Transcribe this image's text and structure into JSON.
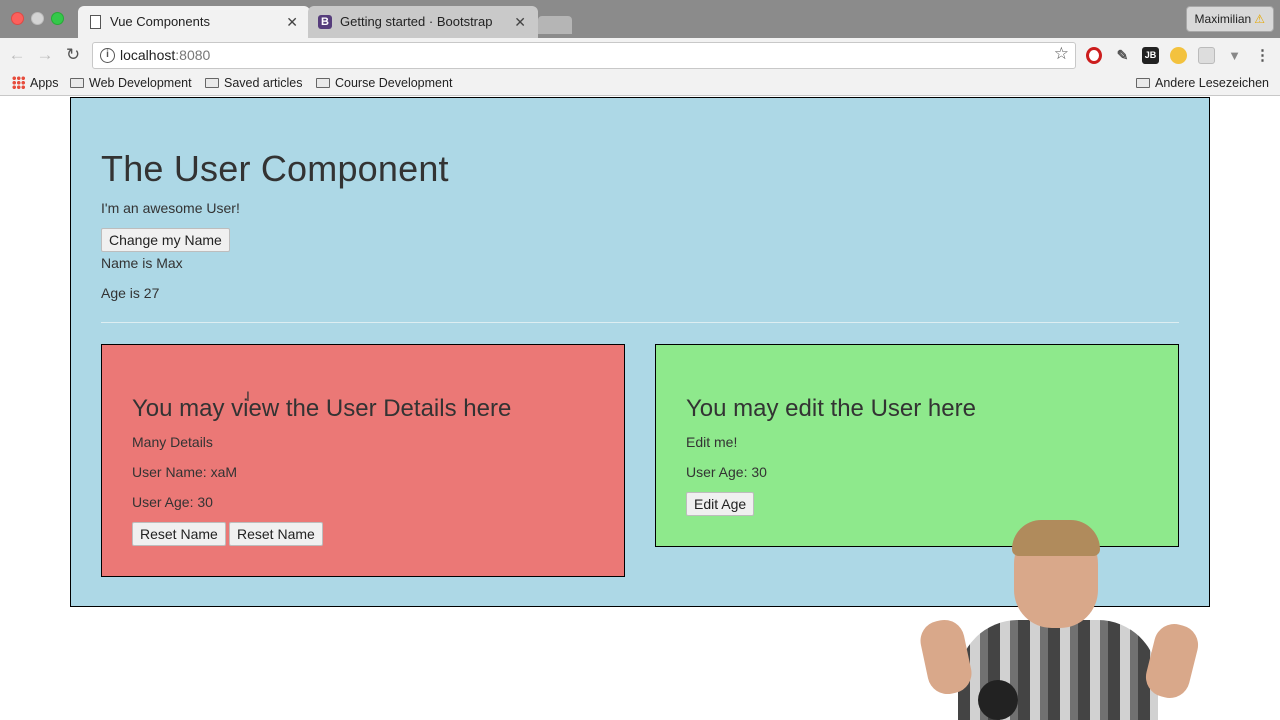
{
  "browser": {
    "tabs": [
      {
        "title": "Vue Components",
        "active": true
      },
      {
        "title": "Getting started · Bootstrap",
        "active": false
      }
    ],
    "profile_name": "Maximilian",
    "url_host": "localhost",
    "url_port": ":8080",
    "bookmarks": [
      "Apps",
      "Web Development",
      "Saved articles",
      "Course Development"
    ],
    "other_bookmarks": "Andere Lesezeichen"
  },
  "user": {
    "title": "The User Component",
    "subtitle": "I'm an awesome User!",
    "change_name_label": "Change my Name",
    "name_text": "Name is Max",
    "age_text": "Age is 27"
  },
  "detail": {
    "title": "You may view the User Details here",
    "text": "Many Details",
    "user_name": "User Name: xaM",
    "user_age": "User Age: 30",
    "reset_label_1": "Reset Name",
    "reset_label_2": "Reset Name"
  },
  "edit": {
    "title": "You may edit the User here",
    "text": "Edit me!",
    "user_age": "User Age: 30",
    "edit_age_label": "Edit Age"
  },
  "colors": {
    "app_background": "#add8e6",
    "detail_background": "#eb7876",
    "edit_background": "#8ee98c"
  }
}
